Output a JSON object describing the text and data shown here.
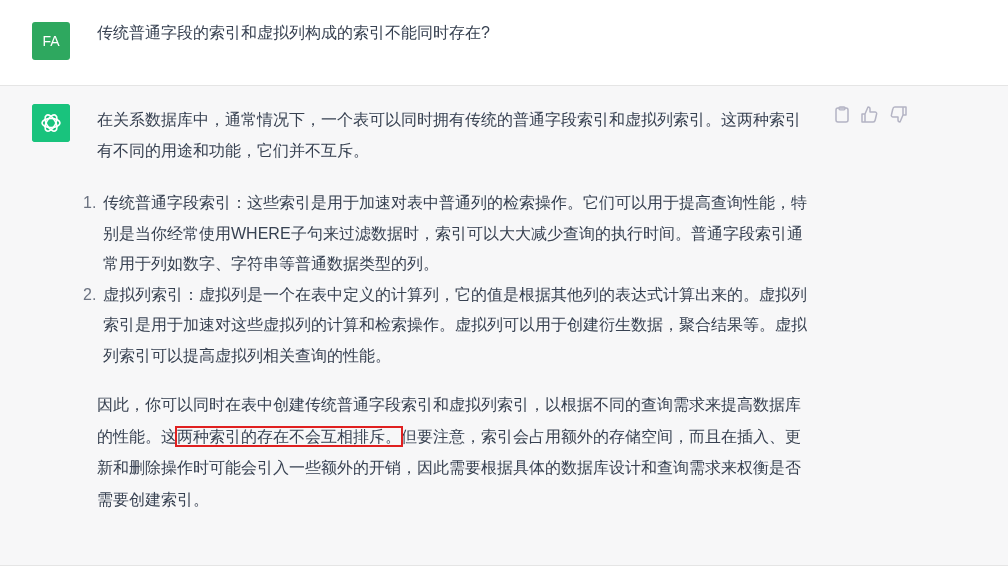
{
  "user_message": {
    "avatar": "FA",
    "text": "传统普通字段的索引和虚拟列构成的索引不能同时存在?"
  },
  "assistant_message": {
    "intro": "在关系数据库中，通常情况下，一个表可以同时拥有传统的普通字段索引和虚拟列索引。这两种索引有不同的用途和功能，它们并不互斥。",
    "list": [
      {
        "number": "1.",
        "text": "传统普通字段索引：这些索引是用于加速对表中普通列的检索操作。它们可以用于提高查询性能，特别是当你经常使用WHERE子句来过滤数据时，索引可以大大减少查询的执行时间。普通字段索引通常用于列如数字、字符串等普通数据类型的列。"
      },
      {
        "number": "2.",
        "text": "虚拟列索引：虚拟列是一个在表中定义的计算列，它的值是根据其他列的表达式计算出来的。虚拟列索引是用于加速对这些虚拟列的计算和检索操作。虚拟列可以用于创建衍生数据，聚合结果等。虚拟列索引可以提高虚拟列相关查询的性能。"
      }
    ],
    "conclusion": [
      {
        "text": "因此，你可以同时在表中创建传统普通字段索引和虚拟列索引，以根据不同的查询需求来提高数据库的性能。这",
        "highlighted": false
      },
      {
        "text": "两种索引的存在不会互相排斥。",
        "highlighted": true
      },
      {
        "text": "但要注意，索引会占用额外的存储空间，而且在插入、更新和删除操作时可能会引入一些额外的开销，因此需要根据具体的数据库设计和查询需求来权衡是否需要创建索引。",
        "highlighted": false
      }
    ]
  }
}
